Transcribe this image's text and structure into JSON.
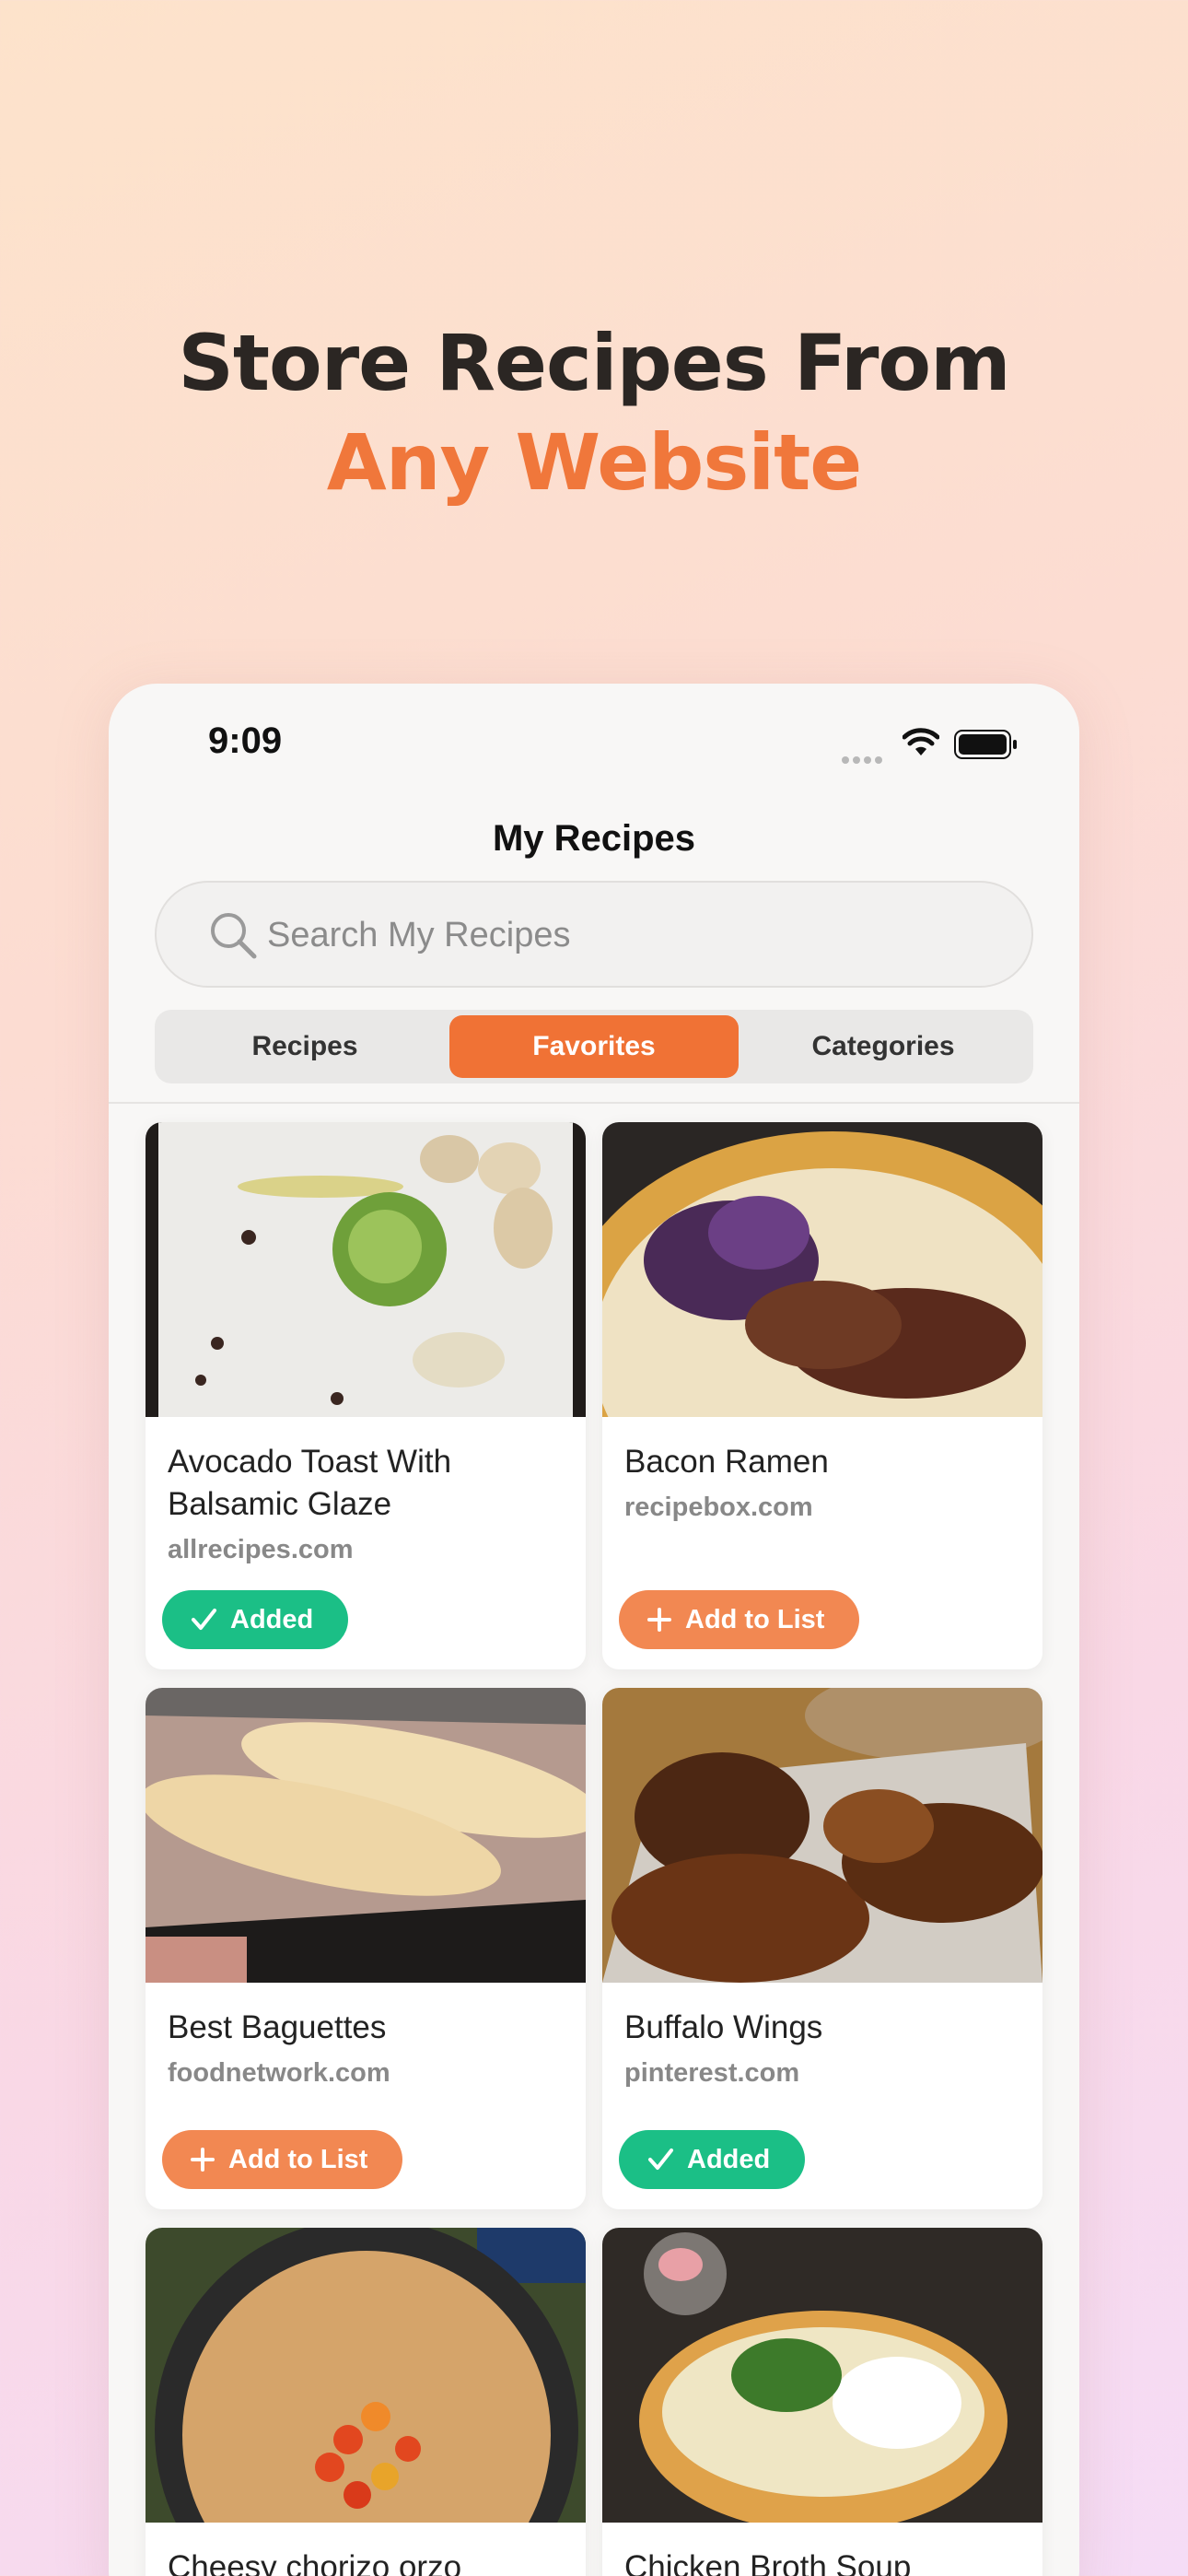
{
  "headline": {
    "line1": "Store Recipes From",
    "line2": "Any Website"
  },
  "status_bar": {
    "time": "9:09"
  },
  "nav": {
    "title": "My Recipes"
  },
  "search": {
    "placeholder": "Search My Recipes",
    "icon": "search-icon"
  },
  "segments": [
    {
      "label": "Recipes",
      "selected": false
    },
    {
      "label": "Favorites",
      "selected": true
    },
    {
      "label": "Categories",
      "selected": false
    }
  ],
  "colors": {
    "accent": "#f07235",
    "added": "#1bbf86",
    "add": "#f28852",
    "headline_dark": "#2b2623",
    "headline_accent": "#f0773b"
  },
  "recipes": [
    {
      "title": "Avocado Toast With Balsamic Glaze",
      "source": "allrecipes.com",
      "button": "Added",
      "state": "added"
    },
    {
      "title": "Bacon Ramen",
      "source": "recipebox.com",
      "button": "Add to List",
      "state": "add"
    },
    {
      "title": "Best Baguettes",
      "source": "foodnetwork.com",
      "button": "Add to List",
      "state": "add"
    },
    {
      "title": "Buffalo Wings",
      "source": "pinterest.com",
      "button": "Added",
      "state": "added"
    },
    {
      "title": "Cheesy chorizo orzo",
      "source": "",
      "button": "",
      "state": ""
    },
    {
      "title": "Chicken Broth Soup",
      "source": "",
      "button": "",
      "state": ""
    }
  ]
}
